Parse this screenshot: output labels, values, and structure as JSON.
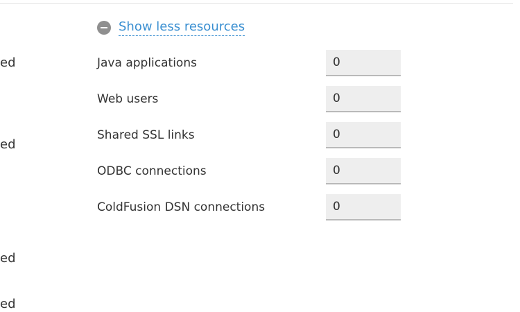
{
  "left_column": {
    "fragments": [
      "ed",
      "ed",
      "ed",
      "ed"
    ]
  },
  "toggle": {
    "icon": "minus-circle-icon",
    "label": "Show less resources"
  },
  "resources": [
    {
      "label": "Java applications",
      "value": "0"
    },
    {
      "label": "Web users",
      "value": "0"
    },
    {
      "label": "Shared SSL links",
      "value": "0"
    },
    {
      "label": "ODBC connections",
      "value": "0"
    },
    {
      "label": "ColdFusion DSN connections",
      "value": "0"
    }
  ],
  "colors": {
    "link": "#3a8fd1",
    "input_background": "#eeeeee",
    "icon": "#8f8f8f"
  }
}
